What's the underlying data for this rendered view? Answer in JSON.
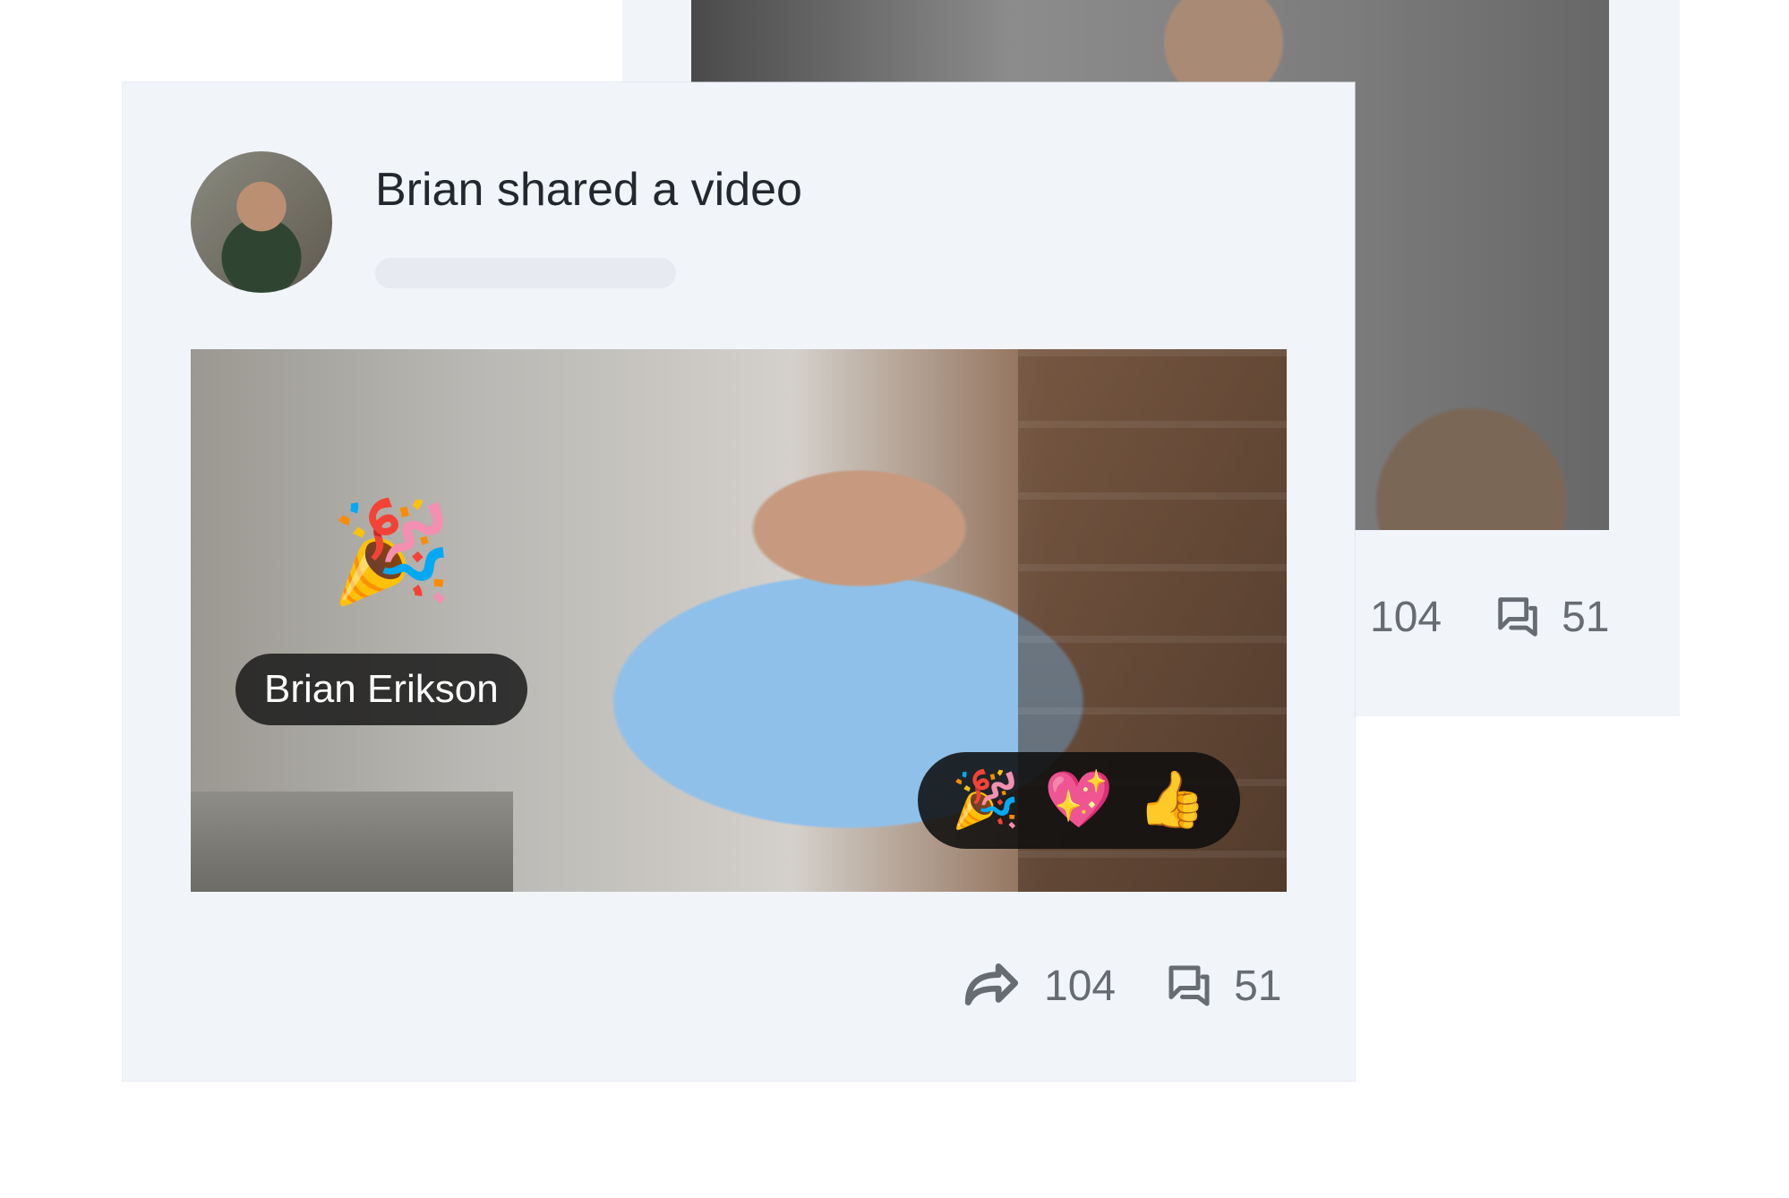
{
  "front_card": {
    "title": "Brian shared a video",
    "video": {
      "name_tag": "Brian Erikson",
      "reactions": [
        "🎉",
        "💖",
        "👍"
      ],
      "overlay_emoji": "🎉"
    },
    "stats": {
      "shares": "104",
      "comments": "51"
    }
  },
  "back_card": {
    "stats": {
      "shares": "104",
      "comments": "51"
    }
  },
  "icons": {
    "share": "share-icon",
    "comment": "comment-icon"
  },
  "colors": {
    "card_bg": "#f1f4f9",
    "text": "#23272f",
    "muted": "#676b72"
  }
}
